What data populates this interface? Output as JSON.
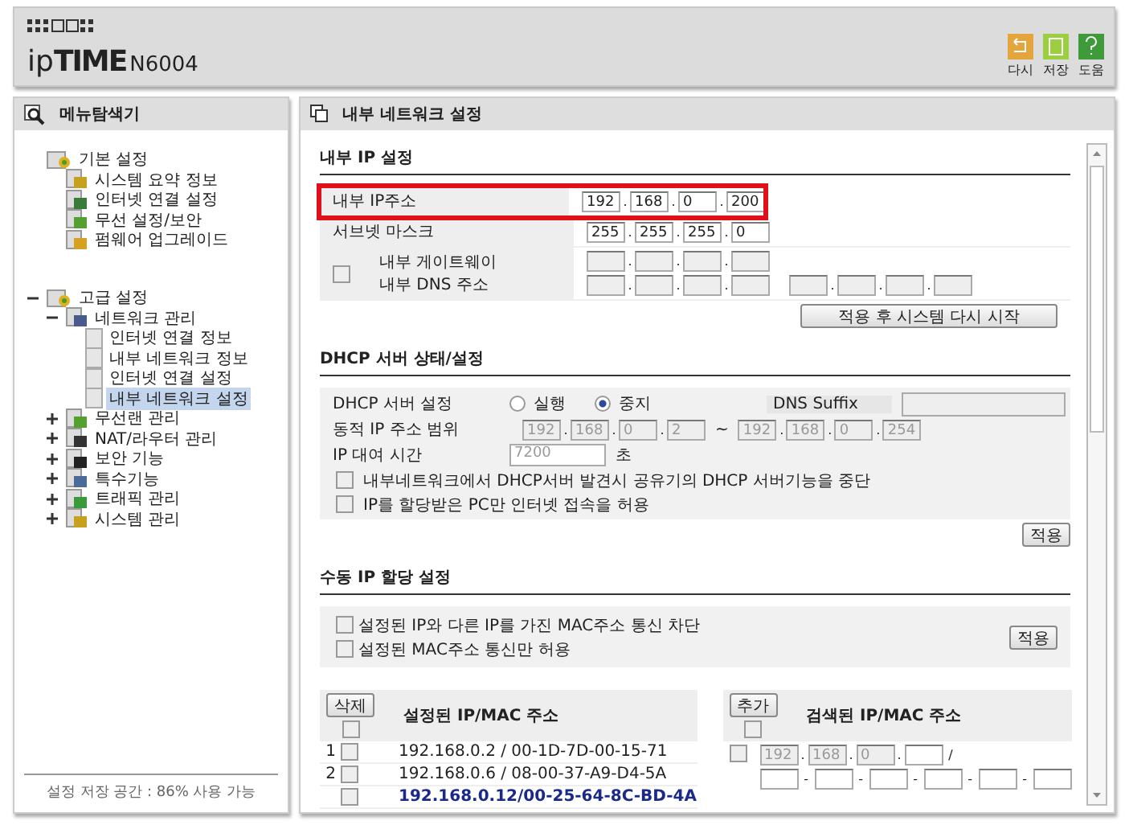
{
  "header": {
    "brand_prefix": "ip",
    "brand": "TIME",
    "model": "N6004",
    "actions": [
      {
        "label": "다시",
        "color": "#e3a53c"
      },
      {
        "label": "저장",
        "color": "#9ccf3f"
      },
      {
        "label": "도움",
        "color": "#3f9a3a"
      }
    ]
  },
  "sidebar": {
    "title": "메뉴탐색기",
    "tree": [
      {
        "label": "기본 설정",
        "kind": "folder",
        "selected": false,
        "children": [
          {
            "label": "시스템 요약 정보",
            "kind": "badge",
            "color": "#c8a020",
            "selected": false
          },
          {
            "label": "인터넷 연결 설정",
            "kind": "badge",
            "color": "#3a7a3a",
            "selected": false
          },
          {
            "label": "무선 설정/보안",
            "kind": "badge",
            "color": "#52a030",
            "selected": false
          },
          {
            "label": "펌웨어 업그레이드",
            "kind": "badge",
            "color": "#d6a020",
            "selected": false
          }
        ]
      },
      {
        "label": "고급 설정",
        "kind": "folder",
        "expanded": true,
        "selected": false,
        "children": [
          {
            "label": "네트워크 관리",
            "kind": "badge",
            "color": "#4a5a8a",
            "expanded": true,
            "selected": false,
            "children": [
              {
                "label": "인터넷 연결 정보",
                "kind": "page",
                "selected": false
              },
              {
                "label": "내부 네트워크 정보",
                "kind": "page",
                "selected": false
              },
              {
                "label": "인터넷 연결 설정",
                "kind": "page",
                "selected": false
              },
              {
                "label": "내부 네트워크 설정",
                "kind": "page",
                "selected": true
              }
            ]
          },
          {
            "label": "무선랜 관리",
            "kind": "badge",
            "color": "#52a030",
            "expanded": false,
            "selected": false
          },
          {
            "label": "NAT/라우터 관리",
            "kind": "badge",
            "color": "#333333",
            "expanded": false,
            "selected": false
          },
          {
            "label": "보안 기능",
            "kind": "badge",
            "color": "#222222",
            "expanded": false,
            "selected": false
          },
          {
            "label": "특수기능",
            "kind": "badge",
            "color": "#4a6a9a",
            "expanded": false,
            "selected": false
          },
          {
            "label": "트래픽 관리",
            "kind": "badge",
            "color": "#3a9a3a",
            "expanded": false,
            "selected": false
          },
          {
            "label": "시스템 관리",
            "kind": "badge",
            "color": "#c8a020",
            "expanded": false,
            "selected": false
          }
        ]
      }
    ],
    "storage_note": "설정 저장 공간 : 86% 사용 가능"
  },
  "main": {
    "title": "내부 네트워크 설정",
    "octet_separator": ".",
    "mac_separator": "-",
    "pair_separator": "/",
    "ip_section": {
      "title": "내부 IP 설정",
      "rows": [
        {
          "label": "내부 IP주소",
          "octets": [
            "192",
            "168",
            "0",
            "200"
          ],
          "highlighted": true
        },
        {
          "label": "서브넷 마스크",
          "octets": [
            "255",
            "255",
            "255",
            "0"
          ],
          "highlighted": false
        }
      ],
      "gateway_dns": {
        "checked": false,
        "labels": [
          "내부 게이트웨이",
          "내부 DNS 주소"
        ]
      },
      "restart_button": "적용 후 시스템 다시 시작"
    },
    "dhcp_section": {
      "title": "DHCP 서버 상태/설정",
      "server_label": "DHCP 서버 설정",
      "radios": [
        {
          "label": "실행",
          "selected": false
        },
        {
          "label": "중지",
          "selected": true
        }
      ],
      "dns_suffix_label": "DNS Suffix",
      "range_label": "동적 IP 주소 범위",
      "disabled": true,
      "range_start": [
        "192",
        "168",
        "0",
        "2"
      ],
      "range_separator": "~",
      "range_end": [
        "192",
        "168",
        "0",
        "254"
      ],
      "lease_label": "IP 대여 시간",
      "lease_value": "7200",
      "lease_unit": "초",
      "options": [
        {
          "label": "내부네트워크에서 DHCP서버 발견시 공유기의 DHCP 서버기능을 중단",
          "checked": false
        },
        {
          "label": "IP를 할당받은 PC만 인터넷 접속을 허용",
          "checked": false
        }
      ],
      "apply_button": "적용"
    },
    "manual_section": {
      "title": "수동 IP 할당 설정",
      "options": [
        {
          "label": "설정된 IP와 다른 IP를 가진 MAC주소 통신 차단",
          "checked": false
        },
        {
          "label": "설정된 MAC주소 통신만 허용",
          "checked": false
        }
      ],
      "apply_button": "적용",
      "assigned": {
        "button": "삭제",
        "heading": "설정된 IP/MAC 주소",
        "select_all": false,
        "rows": [
          {
            "number": "1",
            "text": "192.168.0.2 / 00-1D-7D-00-15-71",
            "checked": false,
            "selected": false
          },
          {
            "number": "2",
            "text": "192.168.0.6 / 08-00-37-A9-D4-5A",
            "checked": false,
            "selected": false
          },
          {
            "text": "192.168.0.12/00-25-64-8C-BD-4A",
            "checked": false,
            "selected": true
          }
        ]
      },
      "found": {
        "button": "추가",
        "heading": "검색된 IP/MAC 주소",
        "select_all": false,
        "entry_checked": false,
        "entry_octets": [
          "192",
          "168",
          "0"
        ]
      }
    }
  }
}
